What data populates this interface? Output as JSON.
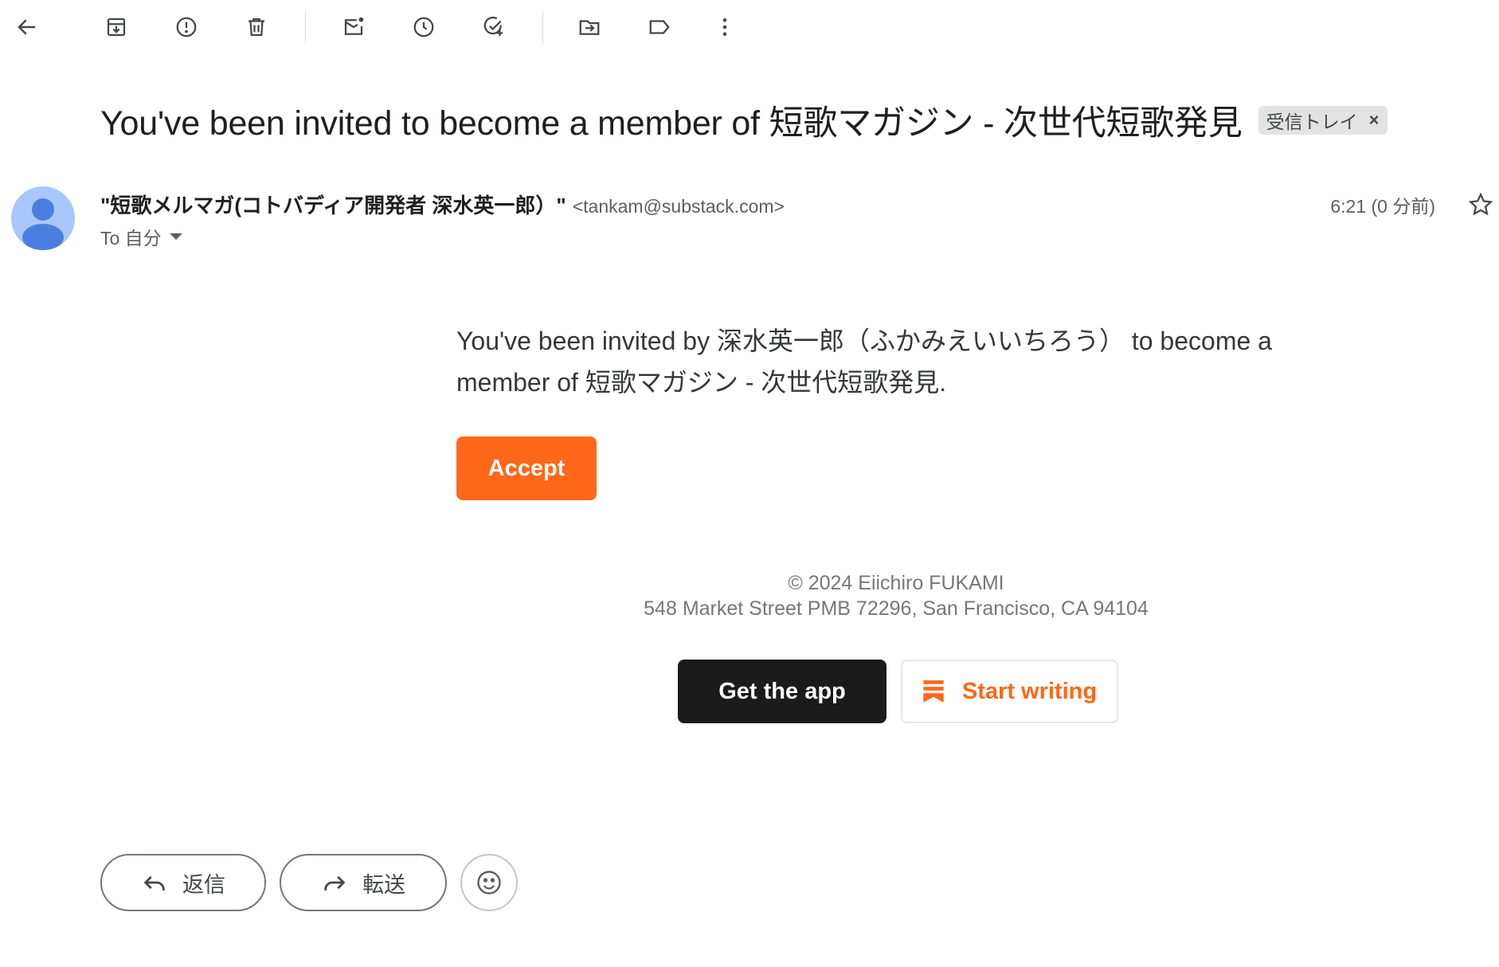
{
  "toolbar": {
    "icons": [
      "back-arrow-icon",
      "archive-icon",
      "report-spam-icon",
      "delete-icon",
      "mark-unread-icon",
      "snooze-icon",
      "add-task-icon",
      "move-to-icon",
      "label-icon",
      "more-vert-icon"
    ]
  },
  "email": {
    "subject": "You've been invited to become a member of 短歌マガジン - 次世代短歌発見",
    "label": "受信トレイ",
    "label_close": "×",
    "sender_name": "\"短歌メルマガ(コトバディア開発者 深水英一郎）\"",
    "sender_email": "<tankam@substack.com>",
    "to": "To 自分",
    "time": "6:21 (0 分前)"
  },
  "body": {
    "invite_text": "You've been invited by 深水英一郎（ふかみえいいちろう） to become a member of 短歌マガジン - 次世代短歌発見.",
    "accept_label": "Accept",
    "copyright": "© 2024 Eiichiro FUKAMI",
    "address": "548 Market Street PMB 72296, San Francisco, CA 94104",
    "get_app_label": "Get the app",
    "start_writing_label": "Start writing"
  },
  "actions": {
    "reply_label": "返信",
    "forward_label": "転送"
  },
  "colors": {
    "accent_orange": "#ff6719",
    "dark_button": "#1b1b1b",
    "avatar_bg": "#a8c7fa",
    "avatar_fg": "#4a7fe0"
  }
}
